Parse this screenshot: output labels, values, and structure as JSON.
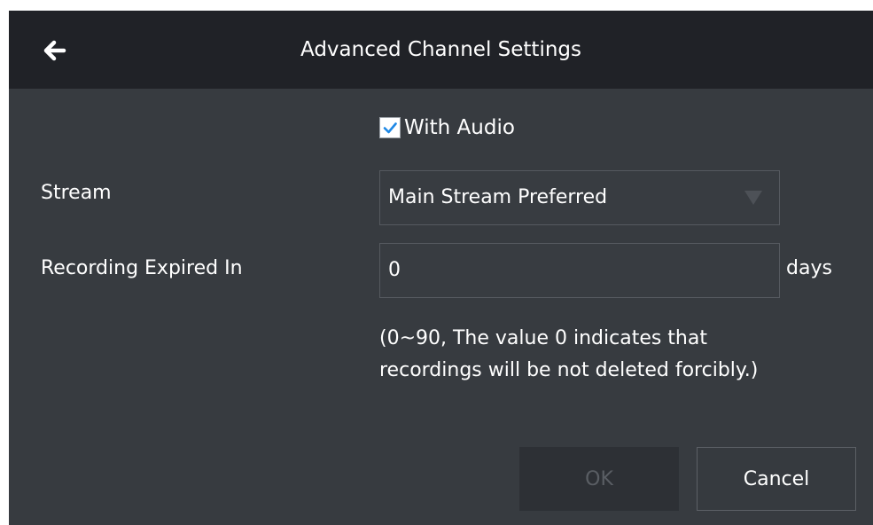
{
  "header": {
    "title": "Advanced Channel Settings",
    "back_icon": "arrow-left-icon"
  },
  "audio": {
    "label": "With Audio",
    "checked": true,
    "check_color": "#1e88e5"
  },
  "stream": {
    "label": "Stream",
    "selected": "Main Stream Preferred",
    "arrow_icon": "triangle-down-icon"
  },
  "expiry": {
    "label": "Recording Expired In",
    "value": "0",
    "unit": "days",
    "hint_line1": "(0~90, The value 0 indicates that",
    "hint_line2": "recordings will be not deleted forcibly.)"
  },
  "buttons": {
    "ok_label": "OK",
    "ok_disabled": true,
    "cancel_label": "Cancel"
  },
  "colors": {
    "header_bg": "#202227",
    "body_bg": "#373b40"
  }
}
